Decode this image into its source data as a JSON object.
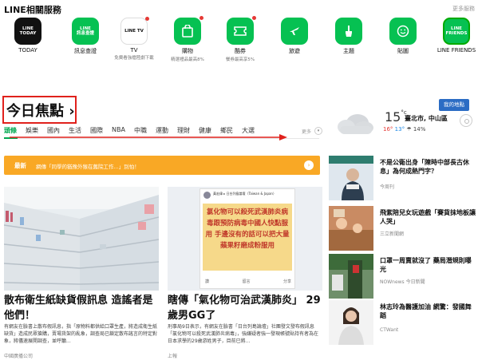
{
  "services": {
    "title": "LINE相關服務",
    "more": "更多服務",
    "items": [
      {
        "name": "TODAY",
        "icon": "line-today-icon",
        "icon_text": "LINE TODAY",
        "sub": "",
        "dot": false
      },
      {
        "name": "訊息查證",
        "icon": "line-factcheck-icon",
        "icon_text": "LINE 訊息查證",
        "sub": "",
        "dot": false
      },
      {
        "name": "TV",
        "icon": "line-tv-icon",
        "icon_text": "LINE TV",
        "sub": "免費看強檔陸劇下載",
        "dot": true
      },
      {
        "name": "購物",
        "icon": "shopping-bag-icon",
        "icon_text": "",
        "sub": "精選禮品最高8%",
        "dot": true
      },
      {
        "name": "酷券",
        "icon": "coupon-icon",
        "icon_text": "",
        "sub": "餐券最高享5%",
        "dot": true
      },
      {
        "name": "旅遊",
        "icon": "airplane-icon",
        "icon_text": "",
        "sub": "",
        "dot": false
      },
      {
        "name": "主題",
        "icon": "paintbrush-icon",
        "icon_text": "",
        "sub": "",
        "dot": false
      },
      {
        "name": "貼圖",
        "icon": "smiley-icon",
        "icon_text": "",
        "sub": "",
        "dot": false
      },
      {
        "name": "LINE FRIENDS",
        "icon": "line-friends-icon",
        "icon_text": "LINE FRIENDS",
        "sub": "",
        "dot": false
      }
    ]
  },
  "focus": {
    "title": "今日焦點 ›"
  },
  "tabs": [
    "頭條",
    "娛樂",
    "國內",
    "生活",
    "國際",
    "NBA",
    "中職",
    "運動",
    "理財",
    "健康",
    "鄉民",
    "大選"
  ],
  "tabs_more": "更多",
  "weather": {
    "temp": "15",
    "unit": "°c",
    "city": "臺北市, 中山區",
    "high": "16°",
    "low": "13°",
    "rain": "14%",
    "location_btn": "我的地點"
  },
  "ticker": {
    "tag": "最新",
    "text": "網傳「同學的猶豫外猴在舊院工作...」別怕！"
  },
  "cards": [
    {
      "title": "散布衛生紙缺貨假訊息 造謠者是他們！",
      "snippet": "有網友在臉書上散布假訊息，指「原物料都供給口罩生產，將造成衛生紙缺貨」造成民眾搶購，賣場貨架的亂象，調查局已鎖定散布謠言的特定對象，將儘速展開調查，並呼籲...",
      "source": "中國廣播公司"
    },
    {
      "title": "瞎傳「氣化物可治武漢肺炎」 29歲男GG了",
      "snippet": "刑事局9日表示，有網友在臉書「日台列島論壇」社團發文發布假訊息「氯化物可以殺死武漢肺炎病毒」，強嫌疑者強一發現帳號貼持有者為在日本求學的29歲游姓男子，目前已將...",
      "source": "上報"
    }
  ],
  "post_image": {
    "poster": "黃宏偉 ▸ 日台列島論壇（Taiwan & Japan）",
    "text": "氯化物可以殺死武漢肺炎病毒跟預防病毒中國人快點服用 手邊沒有的話可以把大量蘋果籽磨成粉服用",
    "actions": [
      "讚",
      "留言",
      "分享"
    ]
  },
  "side": [
    {
      "title": "不是公衛出身「陳時中部長古休息」為何成熱門字？",
      "source": "今周刊"
    },
    {
      "title": "飛紫陪兒女玩遊戲「賽貨抹地板讓人哭」",
      "source": "三立新聞網"
    },
    {
      "title": "口罩一周賣就沒了 藥局潛規則曝光",
      "source": "NOWnews 今日新聞"
    },
    {
      "title": "林志玲為醫護加油 網驚：發國舞蹈",
      "source": "CTWant"
    }
  ],
  "colors": {
    "line_green": "#06c152",
    "tab_active": "#00a84f",
    "ticker": "#f9a825",
    "highlight_red": "#e0211c",
    "location_blue": "#2b6cc4"
  }
}
